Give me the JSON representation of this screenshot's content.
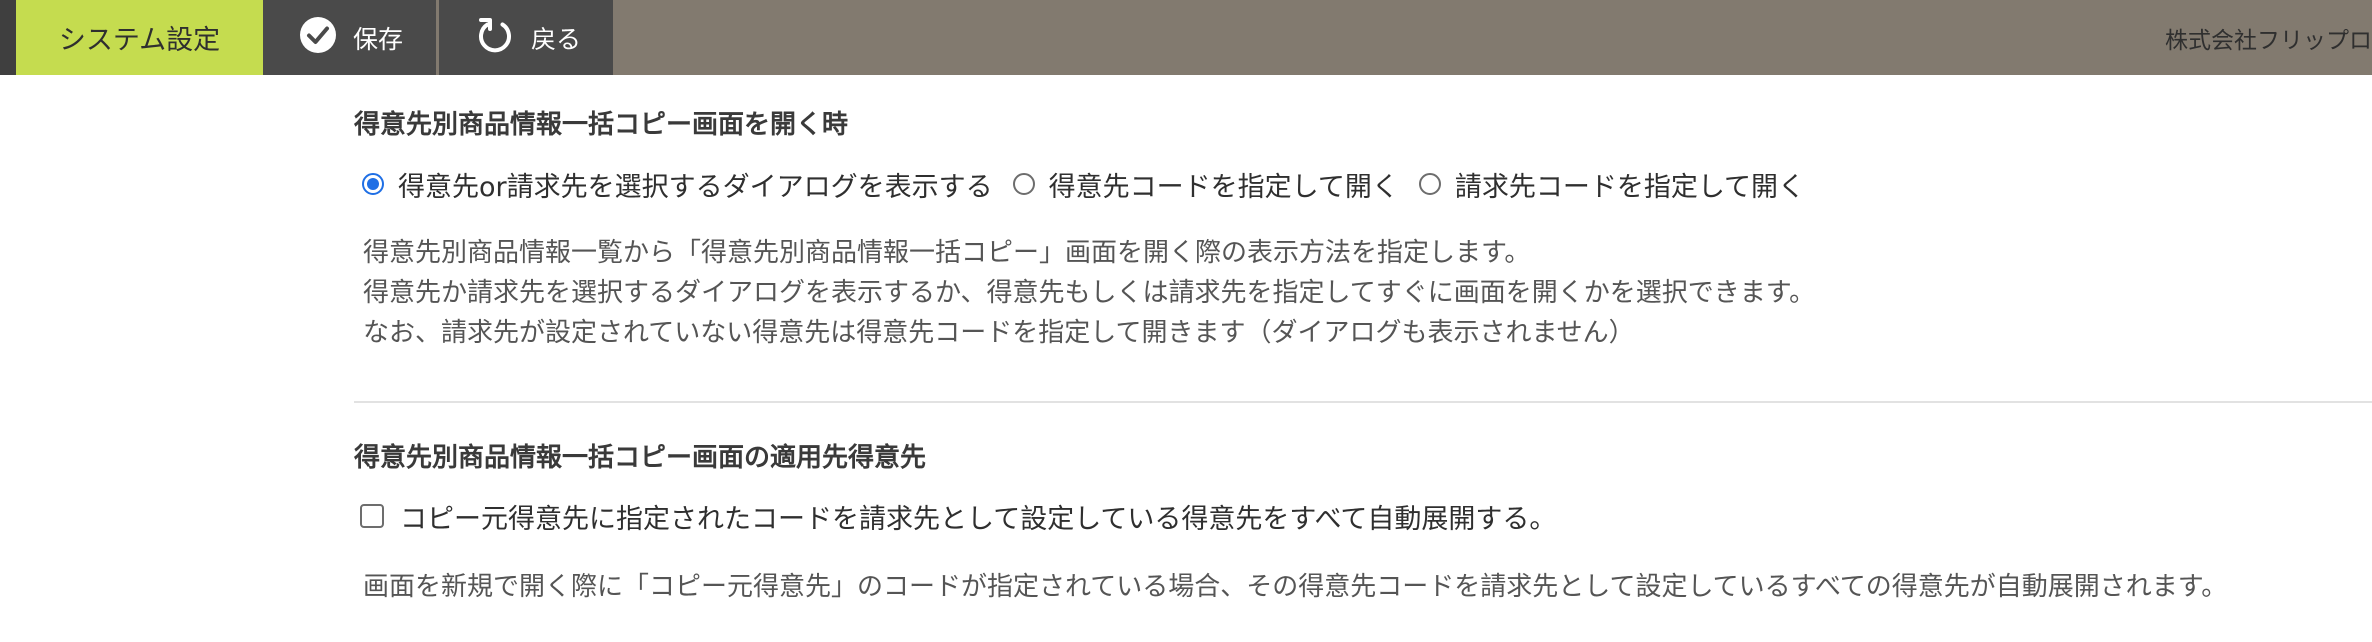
{
  "toolbar": {
    "active_tab": "システム設定",
    "save_label": "保存",
    "back_label": "戻る",
    "company": "株式会社フリップロ",
    "colors": {
      "bar": "#827a6f",
      "active_tab": "#c5dc4f",
      "button": "#4a4a4a"
    },
    "icons": {
      "save": "check-circle-icon",
      "back": "refresh-back-icon"
    }
  },
  "section1": {
    "title": "得意先別商品情報一括コピー画面を開く時",
    "options": [
      {
        "label": "得意先or請求先を選択するダイアログを表示する",
        "checked": true
      },
      {
        "label": "得意先コードを指定して開く",
        "checked": false
      },
      {
        "label": "請求先コードを指定して開く",
        "checked": false
      }
    ],
    "description": [
      "得意先別商品情報一覧から「得意先別商品情報一括コピー」画面を開く際の表示方法を指定します。",
      "得意先か請求先を選択するダイアログを表示するか、得意先もしくは請求先を指定してすぐに画面を開くかを選択できます。",
      "なお、請求先が設定されていない得意先は得意先コードを指定して開きます（ダイアログも表示されません）"
    ]
  },
  "section2": {
    "title": "得意先別商品情報一括コピー画面の適用先得意先",
    "checkbox_label": "コピー元得意先に指定されたコードを請求先として設定している得意先をすべて自動展開する。",
    "checked": false,
    "description": "画面を新規で開く際に「コピー元得意先」のコードが指定されている場合、その得意先コードを請求先として設定しているすべての得意先が自動展開されます。"
  }
}
